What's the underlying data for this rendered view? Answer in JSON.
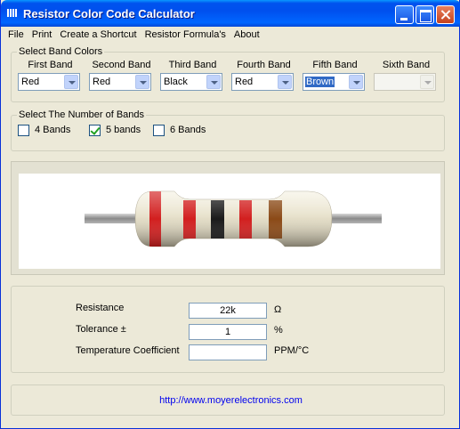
{
  "window": {
    "title": "Resistor Color Code Calculator"
  },
  "menu": [
    "File",
    "Print",
    "Create a Shortcut",
    "Resistor Formula's",
    "About"
  ],
  "band_colors": {
    "group_label": "Select Band Colors",
    "bands": [
      {
        "label": "First Band",
        "value": "Red"
      },
      {
        "label": "Second Band",
        "value": "Red"
      },
      {
        "label": "Third Band",
        "value": "Black"
      },
      {
        "label": "Fourth Band",
        "value": "Red"
      },
      {
        "label": "Fifth Band",
        "value": "Brown"
      },
      {
        "label": "Sixth Band",
        "value": ""
      }
    ]
  },
  "band_count": {
    "group_label": "Select The Number of Bands",
    "options": [
      {
        "label": "4 Bands",
        "checked": false
      },
      {
        "label": "5 bands",
        "checked": true
      },
      {
        "label": "6 Bands",
        "checked": false
      }
    ]
  },
  "resistor_colors": {
    "body": "#e8e2cd",
    "lead": "#9a9a9a",
    "bands": [
      "#d21f1f",
      "#d21f1f",
      "#1a1a1a",
      "#d21f1f",
      "#8b4a17"
    ]
  },
  "results": {
    "resistance": {
      "label": "Resistance",
      "value": "22k",
      "unit": "Ω"
    },
    "tolerance": {
      "label": "Tolerance ±",
      "value": "1",
      "unit": "%"
    },
    "temp_coeff": {
      "label": "Temperature Coefficient",
      "value": "",
      "unit": "PPM/°C"
    }
  },
  "footer": {
    "link": "http://www.moyerelectronics.com"
  }
}
